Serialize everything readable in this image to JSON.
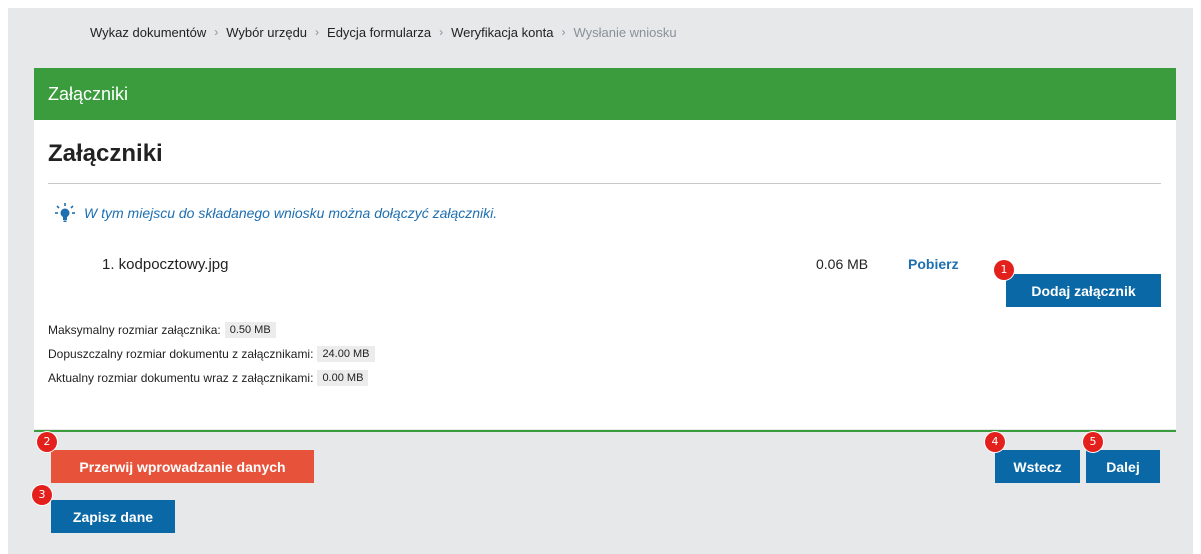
{
  "breadcrumb": {
    "items": [
      {
        "label": "Wykaz dokumentów"
      },
      {
        "label": "Wybór urzędu"
      },
      {
        "label": "Edycja formularza"
      },
      {
        "label": "Weryfikacja konta"
      },
      {
        "label": "Wysłanie wniosku"
      }
    ],
    "separator": "›"
  },
  "panel": {
    "header_title": "Załączniki",
    "section_title": "Załączniki",
    "info_text": "W tym miejscu do składanego wniosku można dołączyć załączniki.",
    "info_icon": "lightbulb-icon"
  },
  "attachments": [
    {
      "index_name": "1. kodpocztowy.jpg",
      "size": "0.06 MB",
      "action": "Pobierz"
    }
  ],
  "buttons": {
    "add_attachment": "Dodaj załącznik",
    "abort": "Przerwij wprowadzanie danych",
    "save": "Zapisz dane",
    "back": "Wstecz",
    "next": "Dalej"
  },
  "limits": {
    "max_attachment_label": "Maksymalny rozmiar załącznika:",
    "max_attachment_value": "0.50 MB",
    "allowed_doc_label": "Dopuszczalny rozmiar dokumentu z załącznikami:",
    "allowed_doc_value": "24.00 MB",
    "current_doc_label": "Aktualny rozmiar dokumentu wraz z załącznikami:",
    "current_doc_value": "0.00 MB"
  },
  "badges": {
    "b1": "1",
    "b2": "2",
    "b3": "3",
    "b4": "4",
    "b5": "5"
  },
  "colors": {
    "header_green": "#3b9c3d",
    "primary_blue": "#0a68a6",
    "danger_red": "#e6533a",
    "badge_red": "#e3201b",
    "link_blue": "#1e6fb0"
  }
}
